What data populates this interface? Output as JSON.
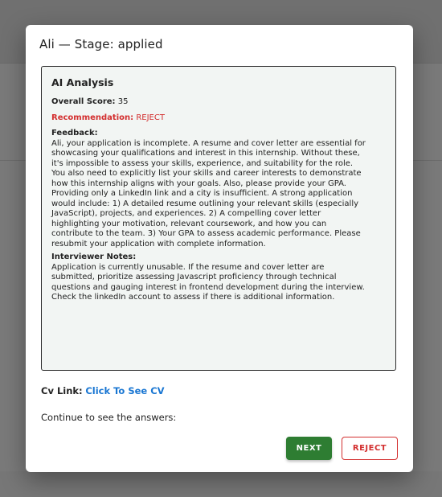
{
  "modal": {
    "title": "Ali — Stage: applied"
  },
  "analysis": {
    "heading": "AI Analysis",
    "score_label": "Overall Score:",
    "score_value": "35",
    "recommendation_label": "Recommendation:",
    "recommendation_value": "REJECT",
    "feedback_label": "Feedback:",
    "feedback_text": "Ali, your application is incomplete. A resume and cover letter are essential for\nshowcasing your qualifications and interest in this internship. Without these,\nit's impossible to assess your skills, experience, and suitability for the role.\nYou also need to explicitly list your skills and career interests to demonstrate\nhow this internship aligns with your goals. Also, please provide your GPA.\nProviding only a LinkedIn link and a city is insufficient. A strong application\nwould include: 1) A detailed resume outlining your relevant skills (especially\nJavaScript), projects, and experiences. 2) A compelling cover letter\nhighlighting your motivation, relevant coursework, and how you can\ncontribute to the team. 3) Your GPA to assess academic performance. Please\nresubmit your application with complete information.",
    "notes_label": "Interviewer Notes:",
    "notes_text": "Application is currently unusable. If the resume and cover letter are\nsubmitted, prioritize assessing Javascript proficiency through technical\nquestions and gauging interest in frontend development during the interview.\nCheck the linkedIn account to assess if there is additional information."
  },
  "cv": {
    "label": "Cv Link:",
    "link_text": "Click To See CV"
  },
  "continue_text": "Continue to see the answers:",
  "actions": {
    "next_label": "NEXT",
    "reject_label": "REJECT"
  },
  "colors": {
    "next_button": "#2e7d32",
    "reject": "#d32f2f",
    "link": "#1976d2",
    "analysis_bg": "#f2f5f3"
  }
}
